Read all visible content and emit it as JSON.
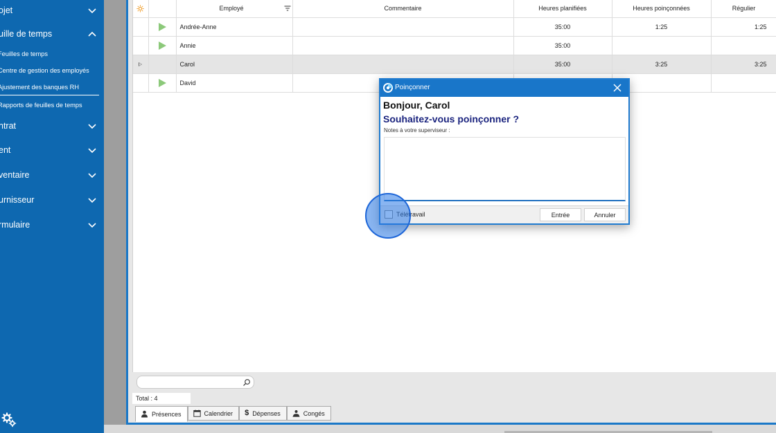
{
  "sidebar": {
    "sections": [
      {
        "label": "ojet",
        "expanded": false
      },
      {
        "label": "uille de temps",
        "expanded": true
      },
      {
        "label": "ntrat",
        "expanded": false
      },
      {
        "label": "ent",
        "expanded": false
      },
      {
        "label": "ventaire",
        "expanded": false
      },
      {
        "label": "urnisseur",
        "expanded": false
      },
      {
        "label": "rmulaire",
        "expanded": false
      }
    ],
    "sub_items": [
      {
        "label": "Feuilles de temps"
      },
      {
        "label": "Centre de gestion des employés"
      },
      {
        "label": "Ajustement des banques RH"
      },
      {
        "label": "Rapports de feuilles de temps"
      }
    ],
    "bg_color": "#0e68b0",
    "settings_icon": "gears-icon"
  },
  "grid": {
    "columns": {
      "employee": "Employé",
      "comment": "Commentaire",
      "planned": "Heures planifiées",
      "punched": "Heures poinçonnées",
      "regular": "Régulier"
    },
    "rows": [
      {
        "employee": "Andrée-Anne",
        "comment": "",
        "planned": "35:00",
        "punched": "1:25",
        "regular": "1:25",
        "selected": false
      },
      {
        "employee": "Annie",
        "comment": "",
        "planned": "35:00",
        "punched": "",
        "regular": "",
        "selected": false
      },
      {
        "employee": "Carol",
        "comment": "",
        "planned": "35:00",
        "punched": "3:25",
        "regular": "3:25",
        "selected": true
      },
      {
        "employee": "David",
        "comment": "",
        "planned": "",
        "punched": "",
        "regular": "",
        "selected": false
      }
    ],
    "play_color": "#8cc97a"
  },
  "footer": {
    "search_placeholder": "",
    "total_label": "Total : 4"
  },
  "tabs": [
    {
      "label": "Présences",
      "icon": "person-icon",
      "active": true
    },
    {
      "label": "Calendrier",
      "icon": "calendar-icon",
      "active": false
    },
    {
      "label": "Dépenses",
      "icon": "dollar-icon",
      "active": false
    },
    {
      "label": "Congés",
      "icon": "vacation-icon",
      "active": false
    }
  ],
  "dialog": {
    "title": "Poinçonner",
    "greeting": "Bonjour, Carol",
    "question": "Souhaitez-vous poinçonner ?",
    "notes_label": "Notes à votre superviseur :",
    "notes_value": "",
    "telework_label": "Télétravail",
    "telework_checked": false,
    "enter_label": "Entrée",
    "cancel_label": "Annuler",
    "accent_color": "#1976c9",
    "question_color": "#1a237e"
  }
}
